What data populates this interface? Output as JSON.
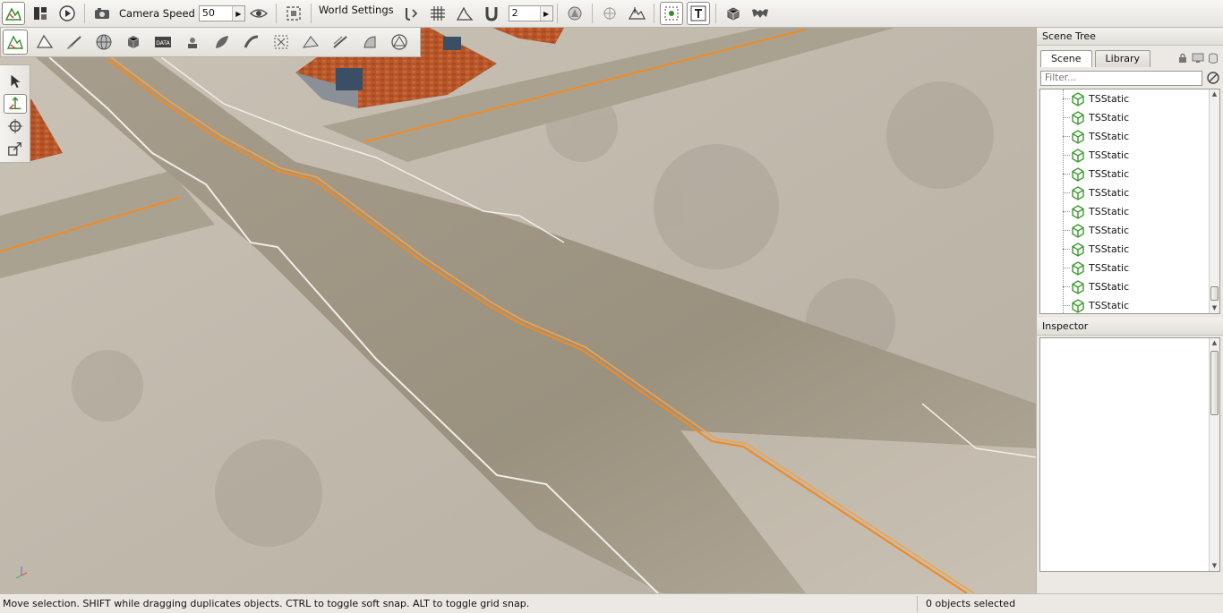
{
  "toolbar": {
    "camera_speed_label": "Camera Speed",
    "camera_speed_value": "50",
    "world_settings_label": "World Settings",
    "snap_value": "2"
  },
  "scene_tree": {
    "title": "Scene Tree",
    "tabs": [
      "Scene",
      "Library"
    ],
    "active_tab": "Scene",
    "filter_placeholder": "Filter...",
    "items": [
      "TSStatic",
      "TSStatic",
      "TSStatic",
      "TSStatic",
      "TSStatic",
      "TSStatic",
      "TSStatic",
      "TSStatic",
      "TSStatic",
      "TSStatic",
      "TSStatic",
      "TSStatic"
    ]
  },
  "inspector": {
    "title": "Inspector"
  },
  "status": {
    "message": "Move selection.  SHIFT while dragging duplicates objects.  CTRL to toggle soft snap.  ALT to toggle grid snap.",
    "selection": "0 objects selected"
  },
  "colors": {
    "accent": "#f08a24",
    "panel_bg": "#ece9e4",
    "tree_icon": "#3a9a2c"
  }
}
